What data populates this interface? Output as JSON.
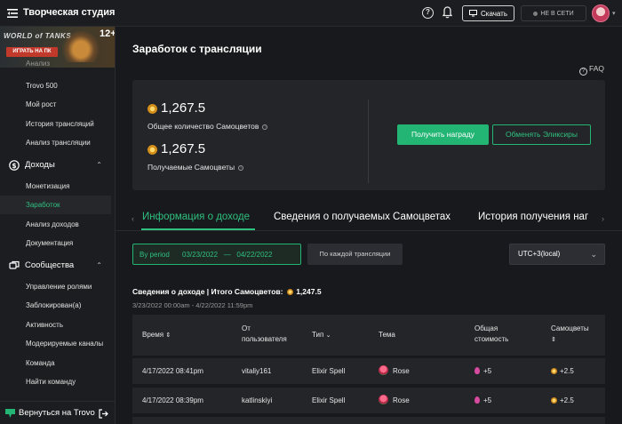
{
  "topbar": {
    "title": "Творческая студия",
    "download_label": "Скачать",
    "status_label": "НЕ В СЕТИ"
  },
  "ad": {
    "logo_text": "WORLD of TANKS",
    "age": "12+",
    "play_label": "ИГРАТЬ НА ПК"
  },
  "sidebar": {
    "partial_item": "Анализ",
    "analytics_items": [
      "Trovo 500",
      "Мой рост",
      "История трансляций",
      "Анализ трансляции"
    ],
    "income_section": "Доходы",
    "income_items": [
      "Монетизация",
      "Заработок",
      "Анализ доходов",
      "Документация"
    ],
    "community_section": "Сообщества",
    "community_items": [
      "Управление ролями",
      "Заблокирован(а)",
      "Активность",
      "Модерируемые каналы",
      "Команда",
      "Найти команду"
    ],
    "back_label": "Вернуться на Trovo"
  },
  "page": {
    "title": "Заработок с трансляции",
    "faq": "FAQ"
  },
  "summary": {
    "total_value": "1,267.5",
    "total_label": "Общее количество Самоцветов",
    "received_value": "1,267.5",
    "received_label": "Получаемые Самоцветы",
    "reward_button": "Получить награду",
    "exchange_button": "Обменять Эликсиры"
  },
  "tabs": [
    "Информация о доходе",
    "Сведения о получаемых Самоцветах",
    "История получения наг"
  ],
  "filters": {
    "period_label": "By period",
    "start_date": "03/23/2022",
    "separator": "—",
    "end_date": "04/22/2022",
    "per_stream": "По каждой трансляции",
    "timezone": "UTC+3(local)"
  },
  "income": {
    "title_prefix": "Сведения о доходе | Итого Самоцветов:",
    "total": "1,247.5",
    "range": "3/23/2022 00:00am - 4/22/2022 11:59pm"
  },
  "table": {
    "headers": {
      "time": "Время",
      "from_line1": "От",
      "from_line2": "пользователя",
      "type": "Тип",
      "topic": "Тема",
      "total_line1": "Общая",
      "total_line2": "стоимость",
      "gems_line1": "Самоцветы"
    },
    "rows": [
      {
        "time": "4/17/2022 08:41pm",
        "user": "vitaliy161",
        "type": "Elixir Spell",
        "topic": "Rose",
        "total": "+5",
        "gems": "+2.5"
      },
      {
        "time": "4/17/2022 08:39pm",
        "user": "katlinskiyi",
        "type": "Elixir Spell",
        "topic": "Rose",
        "total": "+5",
        "gems": "+2.5"
      }
    ]
  },
  "colors": {
    "accent": "#22b573",
    "background": "#18191c",
    "panel": "#242529"
  }
}
